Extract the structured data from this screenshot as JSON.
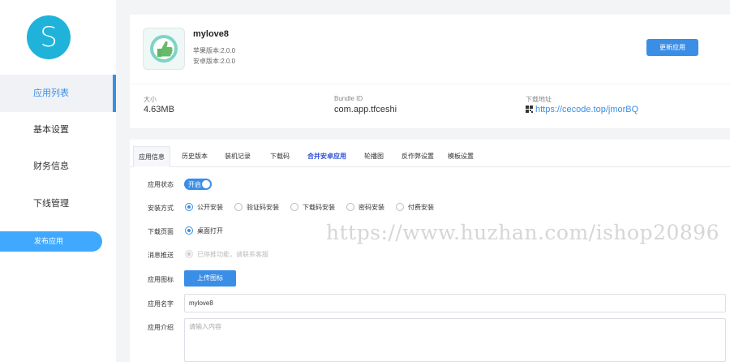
{
  "sidebar": {
    "logo_letter": "S",
    "items": [
      {
        "label": "应用列表",
        "active": true
      },
      {
        "label": "基本设置",
        "active": false
      },
      {
        "label": "财务信息",
        "active": false
      },
      {
        "label": "下线管理",
        "active": false
      }
    ],
    "publish_label": "发布应用"
  },
  "app": {
    "name": "mylove8",
    "ios_version": "苹果版本:2.0.0",
    "android_version": "安卓版本:2.0.0",
    "icon": "thumbs-up-icon",
    "update_label": "更新应用"
  },
  "info": {
    "size_label": "大小",
    "size_value": "4.63MB",
    "bundle_label": "Bundle ID",
    "bundle_value": "com.app.tfceshi",
    "download_label": "下载地址",
    "download_value": "https://cecode.top/jmorBQ"
  },
  "tabs": [
    "应用信息",
    "历史版本",
    "装机记录",
    "下载码",
    "合并安卓应用",
    "轮播图",
    "反作弊设置",
    "模板设置"
  ],
  "form": {
    "status_label": "应用状态",
    "status_toggle": "开启",
    "install_label": "安装方式",
    "install_options": [
      {
        "label": "公开安装",
        "checked": true
      },
      {
        "label": "验证码安装",
        "checked": false
      },
      {
        "label": "下载码安装",
        "checked": false
      },
      {
        "label": "密码安装",
        "checked": false
      },
      {
        "label": "付费安装",
        "checked": false
      }
    ],
    "download_label": "下载页面",
    "download_option": "桌面打开",
    "push_label": "消息推送",
    "push_option": "已停推功能，请联系客服",
    "icon_label": "应用图标",
    "upload_label": "上传图标",
    "name_label": "应用名字",
    "name_value": "mylove8",
    "intro_label": "应用介绍",
    "intro_placeholder": "请输入内容"
  },
  "watermark": "https://www.huzhan.com/ishop20896",
  "colors": {
    "accent": "#3a8ee6",
    "logo": "#1fb3d9",
    "publish": "#40a9ff"
  }
}
